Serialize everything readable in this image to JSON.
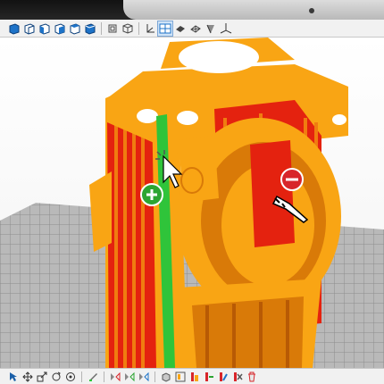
{
  "colors": {
    "part_orange": "#f9a514",
    "part_orange_dark": "#d97a08",
    "part_shadow": "#b85a04",
    "support_red": "#e4220f",
    "support_green": "#2fc43a",
    "grid_line": "#8d8d8d",
    "grid_bg": "#b9b9b9",
    "toolbar_bg": "#f1f1f1",
    "add_marker": "#2ca532",
    "remove_marker": "#d8262a"
  },
  "top_toolbar": {
    "buttons": [
      "view-front-icon",
      "view-back-icon",
      "view-left-icon",
      "view-right-icon",
      "view-top-icon",
      "view-bottom-icon",
      "separator",
      "perspective-icon",
      "isometric-cube-icon",
      "separator",
      "axis-icon",
      "split-view-icon",
      "solid-shading-icon",
      "wireframe-icon",
      "clip-plane-icon",
      "ground-axes-icon"
    ],
    "active": [
      "split-view-icon"
    ]
  },
  "viewport": {
    "model": "3d-print-part-with-supports",
    "brush_tool": "support-paint-brush",
    "markers": [
      {
        "name": "add-support-marker",
        "symbol": "plus"
      },
      {
        "name": "remove-support-marker",
        "symbol": "minus"
      }
    ]
  },
  "bottom_toolbar": {
    "buttons": [
      "select-arrow-icon",
      "move-icon",
      "scale-icon",
      "rotate-icon",
      "target-icon",
      "separator",
      "paint-brush-icon",
      "separator",
      "mirror-x-icon",
      "mirror-y-icon",
      "mirror-z-icon",
      "separator",
      "add-part-icon",
      "layout-icon",
      "support-add-icon",
      "support-remove-icon",
      "support-edit-icon",
      "support-clear-icon",
      "delete-icon"
    ]
  }
}
